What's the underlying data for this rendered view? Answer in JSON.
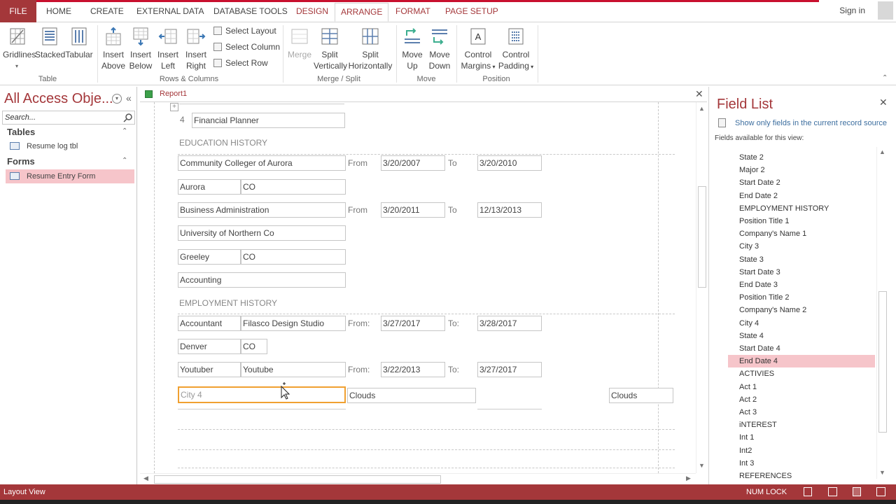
{
  "ribbon": {
    "tabs": [
      "FILE",
      "HOME",
      "CREATE",
      "EXTERNAL DATA",
      "DATABASE TOOLS",
      "DESIGN",
      "ARRANGE",
      "FORMAT",
      "PAGE SETUP"
    ],
    "signin": "Sign in",
    "table_group": {
      "label": "Table",
      "buttons": [
        "Gridlines",
        "Stacked",
        "Tabular"
      ]
    },
    "rows_cols_group": {
      "label": "Rows & Columns",
      "buttons": [
        [
          "Insert",
          "Above"
        ],
        [
          "Insert",
          "Below"
        ],
        [
          "Insert",
          "Left"
        ],
        [
          "Insert",
          "Right"
        ]
      ],
      "small": [
        "Select Layout",
        "Select Column",
        "Select Row"
      ]
    },
    "merge_group": {
      "label": "Merge / Split",
      "merge": "Merge",
      "split_v": [
        "Split",
        "Vertically"
      ],
      "split_h": [
        "Split",
        "Horizontally"
      ]
    },
    "move_group": {
      "label": "Move",
      "up": [
        "Move",
        "Up"
      ],
      "down": [
        "Move",
        "Down"
      ]
    },
    "position_group": {
      "label": "Position",
      "margins": [
        "Control",
        "Margins"
      ],
      "padding": [
        "Control",
        "Padding"
      ]
    }
  },
  "nav": {
    "title": "All Access Obje...",
    "search_placeholder": "Search...",
    "tables_header": "Tables",
    "tables": [
      "Resume log tbl"
    ],
    "forms_header": "Forms",
    "forms": [
      "Resume Entry Form"
    ]
  },
  "document": {
    "tab_label": "Report1",
    "number": "4",
    "financial": "Financial Planner",
    "education_header": "EDUCATION HISTORY",
    "employment_header": "EMPLOYMENT HISTORY",
    "rows": {
      "r1": {
        "a": "Community Colleger of Aurora",
        "from_label": "From",
        "from": "3/20/2007",
        "to_label": "To",
        "to": "3/20/2010"
      },
      "r2": {
        "a": "Aurora",
        "b": "CO"
      },
      "r3": {
        "a": "Business Administration",
        "from_label": "From",
        "from": "3/20/2011",
        "to_label": "To",
        "to": "12/13/2013"
      },
      "r4": {
        "a": "University of Northern Co"
      },
      "r5": {
        "a": "Greeley",
        "b": "CO"
      },
      "r6": {
        "a": "Accounting"
      },
      "r7": {
        "a": "Accountant",
        "b": "Filasco Design Studio",
        "from_label": "From:",
        "from": "3/27/2017",
        "to_label": "To:",
        "to": "3/28/2017"
      },
      "r8": {
        "a": "Denver",
        "b": "CO"
      },
      "r9": {
        "a": "Youtuber",
        "b": "Youtube",
        "from_label": "From:",
        "from": "3/22/2013",
        "to_label": "To:",
        "to": "3/27/2017"
      },
      "r10": {
        "a": "City 4",
        "b": "Clouds",
        "c": "Clouds"
      }
    }
  },
  "field_list": {
    "title": "Field List",
    "link": "Show only fields in the current record source",
    "available": "Fields available for this view:",
    "items": [
      "State 2",
      "Major 2",
      "Start Date 2",
      "End Date 2",
      "EMPLOYMENT HISTORY",
      "Position Title 1",
      "Company's Name 1",
      "City 3",
      "State 3",
      "Start Date 3",
      "End Date 3",
      "Position Title 2",
      "Company's Name 2",
      "City 4",
      "State 4",
      "Start Date 4",
      "End Date 4",
      "ACTIVIES",
      "Act 1",
      "Act 2",
      "Act 3",
      "iNTEREST",
      "Int 1",
      "Int2",
      "Int 3",
      "REFERENCES"
    ],
    "selected_index": 16
  },
  "status": {
    "view": "Layout View",
    "numlock": "NUM LOCK"
  },
  "colors": {
    "accent": "#a4373a",
    "selection": "#f6c5ca",
    "focus": "#f0a030"
  }
}
